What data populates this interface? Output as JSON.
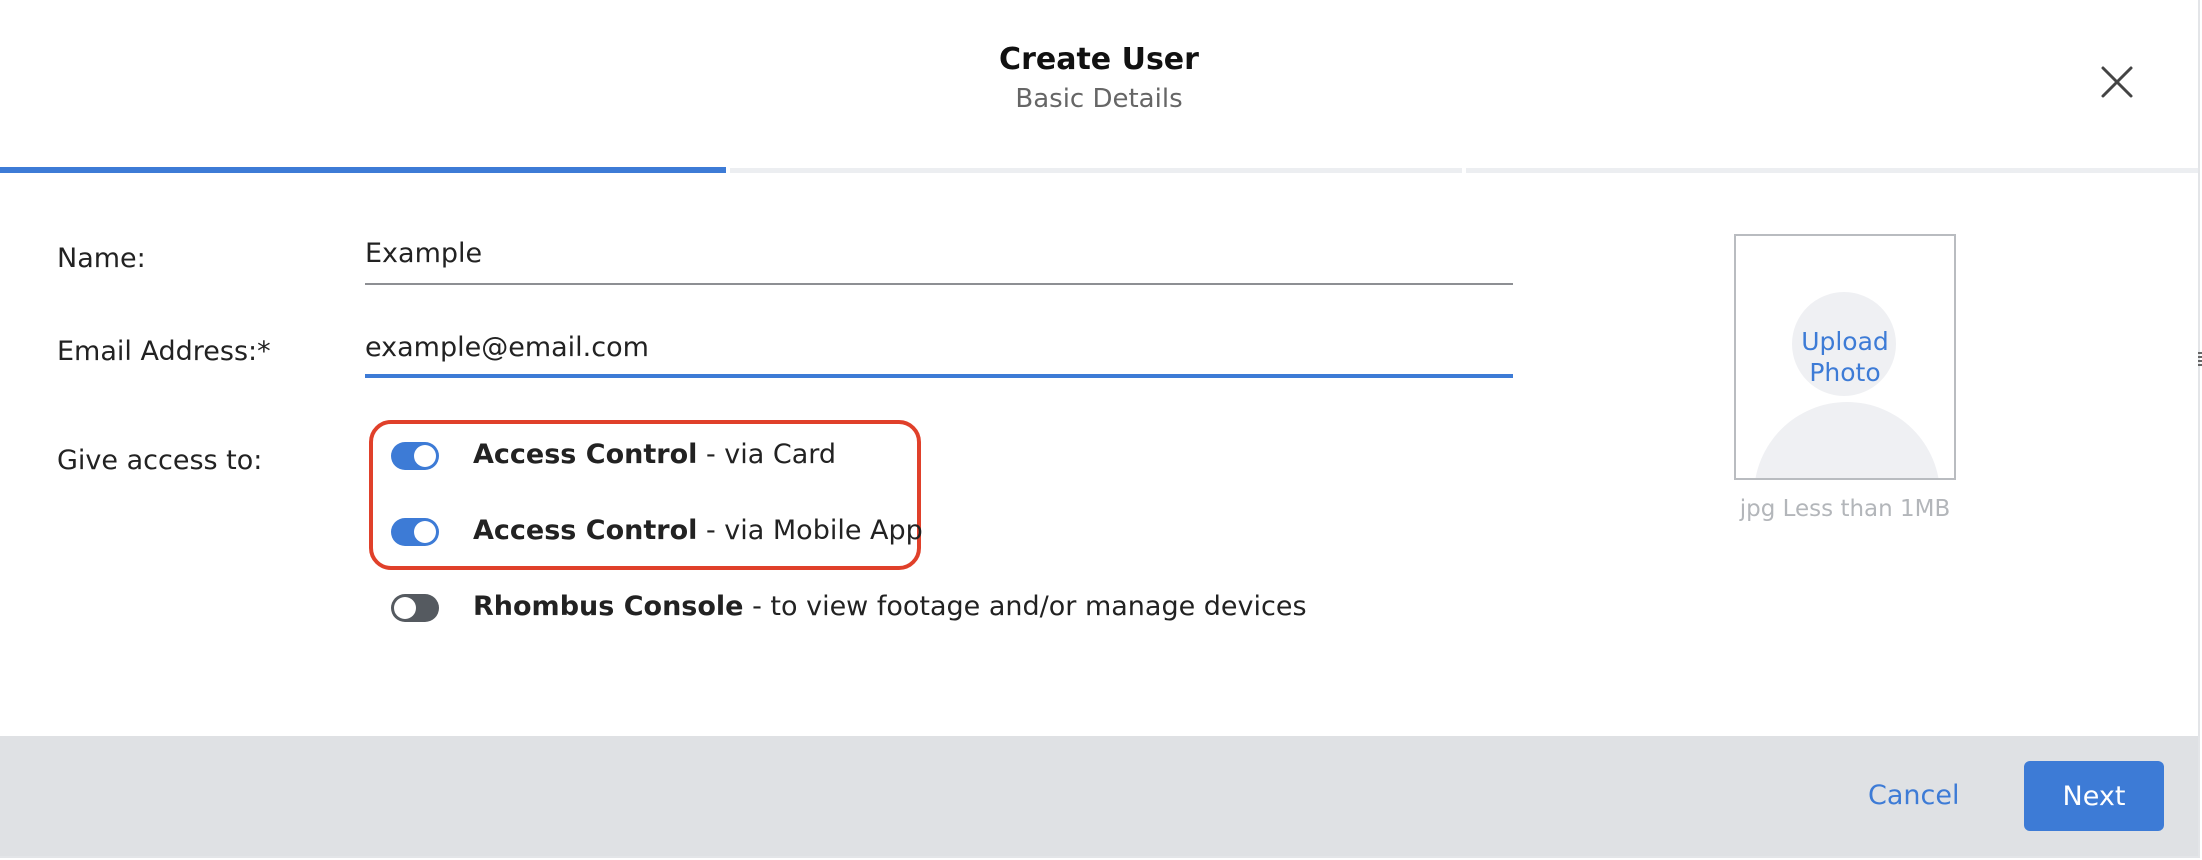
{
  "header": {
    "title": "Create User",
    "subtitle": "Basic Details",
    "close_icon": "close-icon"
  },
  "progress": {
    "steps_total": 3,
    "current_step": 1
  },
  "form": {
    "name_label": "Name:",
    "name_value": "Example",
    "email_label": "Email Address:*",
    "email_value": "example@email.com",
    "access_label": "Give access to:",
    "options": [
      {
        "bold": "Access Control",
        "rest": " - via Card",
        "enabled": true
      },
      {
        "bold": "Access Control",
        "rest": " - via Mobile App",
        "enabled": true
      },
      {
        "bold": "Rhombus Console",
        "rest": " - to view footage and/or manage devices",
        "enabled": false
      }
    ]
  },
  "photo": {
    "upload_line1": "Upload",
    "upload_line2": "Photo",
    "hint": "jpg Less than 1MB"
  },
  "footer": {
    "cancel_label": "Cancel",
    "next_label": "Next"
  },
  "colors": {
    "accent": "#3d7bd6",
    "highlight_border": "#e0402a",
    "footer_bg": "#dfe1e4"
  }
}
